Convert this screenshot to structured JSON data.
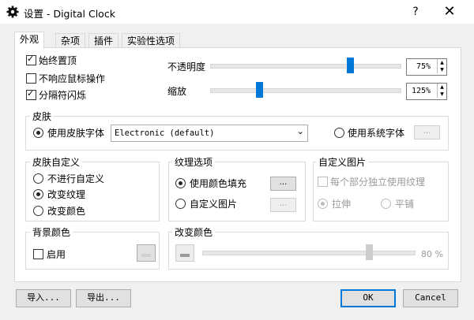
{
  "window": {
    "title": "设置 - Digital Clock",
    "help_glyph": "?",
    "close_glyph": "✕"
  },
  "tabs": [
    {
      "label": "外观",
      "active": true
    },
    {
      "label": "杂项",
      "active": false
    },
    {
      "label": "插件",
      "active": false
    },
    {
      "label": "实验性选项",
      "active": false
    }
  ],
  "appearance": {
    "always_on_top": {
      "label": "始终置顶",
      "checked": true
    },
    "no_mouse": {
      "label": "不响应鼠标操作",
      "checked": false
    },
    "blink_separator": {
      "label": "分隔符闪烁",
      "checked": true
    },
    "opacity": {
      "label": "不透明度",
      "value": "75%",
      "level": 0.75
    },
    "zoom": {
      "label": "缩放",
      "value": "125%",
      "level": 0.25
    }
  },
  "skin": {
    "title": "皮肤",
    "use_skin_font": "使用皮肤字体",
    "skin_selected": "Electronic (default)",
    "use_system_font": "使用系统字体",
    "dots": "..."
  },
  "skin_custom": {
    "title": "皮肤自定义",
    "options": [
      "不进行自定义",
      "改变纹理",
      "改变颜色"
    ],
    "selected": 1
  },
  "texture": {
    "title": "纹理选项",
    "fill_color": "使用颜色填充",
    "custom_image": "自定义图片",
    "dots": "..."
  },
  "custom_image": {
    "title": "自定义图片",
    "per_part": "每个部分独立使用纹理",
    "stretch": "拉伸",
    "tile": "平铺"
  },
  "background_color": {
    "title": "背景颜色",
    "enable": "启用"
  },
  "change_color": {
    "title": "改变颜色",
    "value": "80 %",
    "level": 0.8
  },
  "buttons": {
    "import": "导入...",
    "export": "导出...",
    "ok": "OK",
    "cancel": "Cancel"
  }
}
